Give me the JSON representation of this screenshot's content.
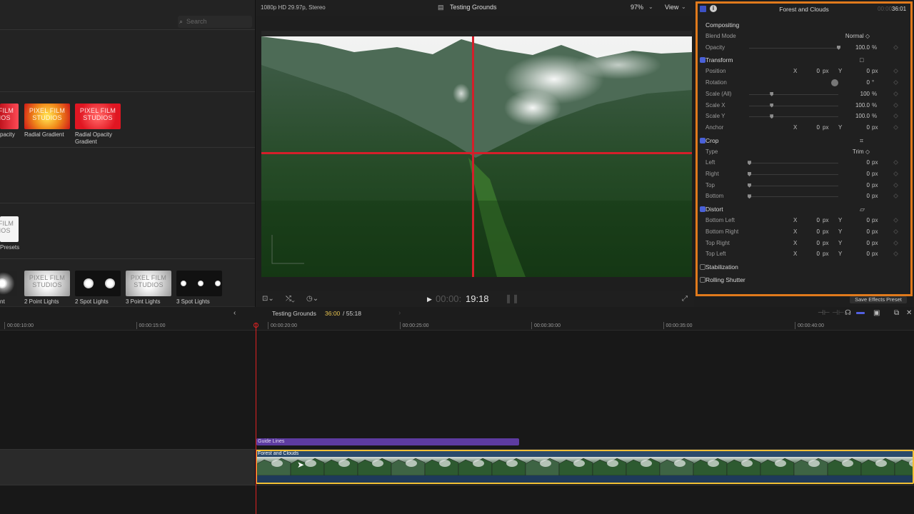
{
  "browser": {
    "search_placeholder": "Search",
    "row1": [
      {
        "label": "pacity",
        "style": "red-partial"
      },
      {
        "label": "Radial Gradient",
        "style": "radial"
      },
      {
        "label": "Radial Opacity Gradient",
        "style": "radial-opacity"
      }
    ],
    "row2": [
      {
        "label": "Presets",
        "style": "white"
      }
    ],
    "row3": [
      {
        "label": "nt",
        "style": "light-partial"
      },
      {
        "label": "2 Point Lights",
        "style": "pointlights"
      },
      {
        "label": "2 Spot Lights",
        "style": "spots"
      },
      {
        "label": "3 Point Lights",
        "style": "pointlights"
      },
      {
        "label": "3 Spot Lights",
        "style": "spots3"
      }
    ],
    "thumb_text_line1": "PIXEL FILM",
    "thumb_text_line2": "STUDIOS"
  },
  "viewer": {
    "format": "1080p HD 29.97p, Stereo",
    "title": "Testing Grounds",
    "zoom": "97%",
    "view_label": "View",
    "timecode_dim": "00:00:",
    "timecode": "19:18"
  },
  "inspector": {
    "title": "Forest and Clouds",
    "time_dim": "00:00:",
    "time": "36:01",
    "save_preset": "Save Effects Preset",
    "rows": [
      {
        "type": "header",
        "label": "Compositing"
      },
      {
        "type": "popup",
        "label": "Blend Mode",
        "value": "Normal ◇"
      },
      {
        "type": "slider",
        "label": "Opacity",
        "value": "100.0",
        "unit": "%",
        "knob": 1.0
      },
      {
        "type": "section",
        "label": "Transform",
        "checked": true,
        "icon": "□"
      },
      {
        "type": "xy",
        "label": "Position",
        "x": "0",
        "y": "0",
        "unit": "px"
      },
      {
        "type": "dial",
        "label": "Rotation",
        "value": "0",
        "unit": "°"
      },
      {
        "type": "slider",
        "label": "Scale (All)",
        "value": "100",
        "unit": "%",
        "knob": 0.25
      },
      {
        "type": "slider",
        "label": "Scale X",
        "value": "100.0",
        "unit": "%",
        "knob": 0.25
      },
      {
        "type": "slider",
        "label": "Scale Y",
        "value": "100.0",
        "unit": "%",
        "knob": 0.25
      },
      {
        "type": "xy",
        "label": "Anchor",
        "x": "0",
        "y": "0",
        "unit": "px"
      },
      {
        "type": "section",
        "label": "Crop",
        "checked": true,
        "icon": "⌗"
      },
      {
        "type": "popup",
        "label": "Type",
        "value": "Trim ◇"
      },
      {
        "type": "slider",
        "label": "Left",
        "value": "0",
        "unit": "px",
        "knob": 0.0
      },
      {
        "type": "slider",
        "label": "Right",
        "value": "0",
        "unit": "px",
        "knob": 0.0
      },
      {
        "type": "slider",
        "label": "Top",
        "value": "0",
        "unit": "px",
        "knob": 0.0
      },
      {
        "type": "slider",
        "label": "Bottom",
        "value": "0",
        "unit": "px",
        "knob": 0.0
      },
      {
        "type": "section",
        "label": "Distort",
        "checked": true,
        "icon": "▱"
      },
      {
        "type": "xy",
        "label": "Bottom Left",
        "x": "0",
        "y": "0",
        "unit": "px"
      },
      {
        "type": "xy",
        "label": "Bottom Right",
        "x": "0",
        "y": "0",
        "unit": "px"
      },
      {
        "type": "xy",
        "label": "Top Right",
        "x": "0",
        "y": "0",
        "unit": "px"
      },
      {
        "type": "xy",
        "label": "Top Left",
        "x": "0",
        "y": "0",
        "unit": "px"
      },
      {
        "type": "section",
        "label": "Stabilization",
        "checked": false,
        "icon": ""
      },
      {
        "type": "section",
        "label": "Rolling Shutter",
        "checked": false,
        "icon": ""
      }
    ]
  },
  "timeline": {
    "project": "Testing Grounds",
    "duration_current": "36:00",
    "duration_total": "/ 55:18",
    "ticks": [
      "00:00:10:00",
      "00:00:15:00",
      "00:00:20:00",
      "00:00:25:00",
      "00:00:30:00",
      "00:00:35:00",
      "00:00:40:00"
    ],
    "guide_clip": "Guide Lines",
    "video_clip": "Forest and Clouds"
  },
  "colors": {
    "accent": "#e07a1c",
    "checkbox": "#4a61d8",
    "guide": "#5d3ba0",
    "selection": "#f2c036",
    "crosshair": "#d41f2a"
  }
}
